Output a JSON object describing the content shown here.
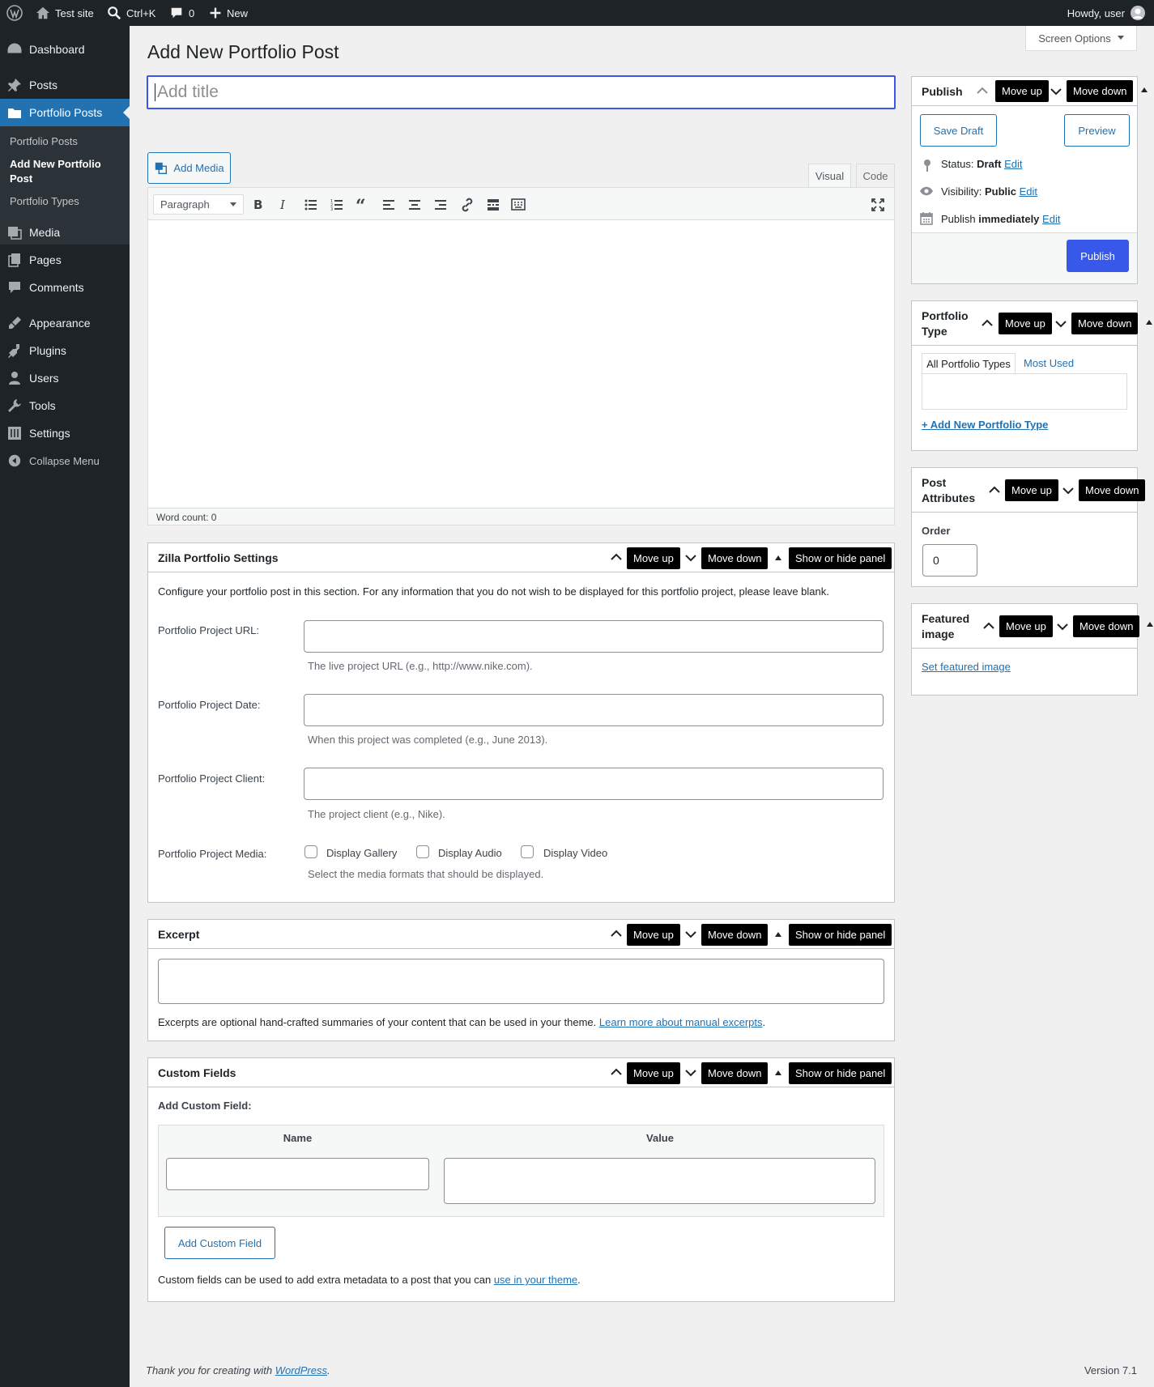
{
  "admin_bar": {
    "site_name": "Test site",
    "search_shortcut": "Ctrl+K",
    "comments_count": "0",
    "new_label": "New",
    "greeting": "Howdy, user"
  },
  "sidebar": {
    "items": [
      {
        "label": "Dashboard"
      },
      {
        "label": "Posts"
      },
      {
        "label": "Portfolio Posts"
      },
      {
        "label": "Media"
      },
      {
        "label": "Pages"
      },
      {
        "label": "Comments"
      },
      {
        "label": "Appearance"
      },
      {
        "label": "Plugins"
      },
      {
        "label": "Users"
      },
      {
        "label": "Tools"
      },
      {
        "label": "Settings"
      }
    ],
    "submenu": [
      "Portfolio Posts",
      "Add New Portfolio Post",
      "Portfolio Types"
    ],
    "collapse_label": "Collapse Menu"
  },
  "screen_options": "Screen Options",
  "page_title": "Add New Portfolio Post",
  "title_input": {
    "placeholder": "Add title",
    "value": ""
  },
  "editor": {
    "add_media": "Add Media",
    "tab_visual": "Visual",
    "tab_code": "Code",
    "format_select": "Paragraph",
    "word_count": "Word count: 0"
  },
  "panel_controls": {
    "move_up": "Move up",
    "move_down": "Move down",
    "toggle": "Show or hide panel"
  },
  "zilla": {
    "title": "Zilla Portfolio Settings",
    "intro": "Configure your portfolio post in this section. For any information that you do not wish to be displayed for this portfolio project, please leave blank.",
    "url_label": "Portfolio Project URL:",
    "url_desc": "The live project URL (e.g., http://www.nike.com).",
    "date_label": "Portfolio Project Date:",
    "date_desc": "When this project was completed (e.g., June 2013).",
    "client_label": "Portfolio Project Client:",
    "client_desc": "The project client (e.g., Nike).",
    "media_label": "Portfolio Project Media:",
    "media_options": [
      "Display Gallery",
      "Display Audio",
      "Display Video"
    ],
    "media_desc": "Select the media formats that should be displayed."
  },
  "excerpt": {
    "title": "Excerpt",
    "desc": "Excerpts are optional hand-crafted summaries of your content that can be used in your theme.",
    "link": "Learn more about manual excerpts",
    "period": "."
  },
  "custom_fields": {
    "title": "Custom Fields",
    "add_label": "Add Custom Field:",
    "col_name": "Name",
    "col_value": "Value",
    "add_button": "Add Custom Field",
    "desc": "Custom fields can be used to add extra metadata to a post that you can",
    "link": "use in your theme",
    "period": "."
  },
  "publish": {
    "title": "Publish",
    "save_draft": "Save Draft",
    "preview": "Preview",
    "status_label": "Status:",
    "status_value": "Draft",
    "visibility_label": "Visibility:",
    "visibility_value": "Public",
    "publish_label": "Publish",
    "publish_value": "immediately",
    "edit": "Edit",
    "publish_button": "Publish"
  },
  "portfolio_type": {
    "title_line1": "Portfolio",
    "title_line2": "Type",
    "tab_all": "All Portfolio Types",
    "tab_most_used": "Most Used",
    "add_new": "+ Add New Portfolio Type"
  },
  "post_attributes": {
    "title_line1": "Post",
    "title_line2": "Attributes",
    "order_label": "Order",
    "order_value": "0"
  },
  "featured_image": {
    "title_line1": "Featured",
    "title_line2": "image",
    "set_link": "Set featured image"
  },
  "footer": {
    "thanks": "Thank you for creating with",
    "wp_link": "WordPress",
    "period": ".",
    "version": "Version 7.1"
  },
  "colors": {
    "admin_bar_bg": "#1d2327",
    "accent": "#2271b1",
    "publish_button": "#3858e9",
    "title_focus": "#3858e9"
  }
}
